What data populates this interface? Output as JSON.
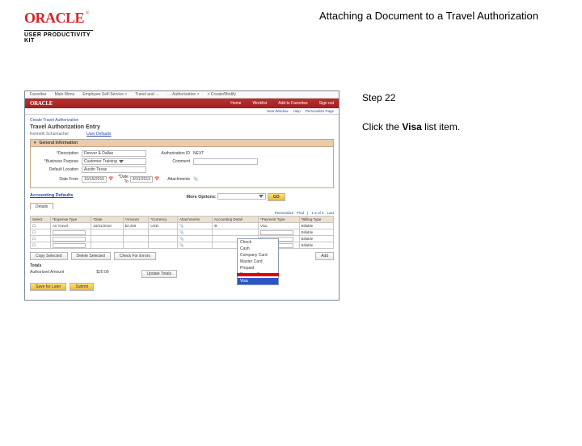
{
  "header": {
    "logo_wordmark": "ORACLE",
    "logo_subtitle": "USER PRODUCTIVITY KIT",
    "doc_title": "Attaching a Document to a Travel Authorization"
  },
  "instructions": {
    "step_label": "Step 22",
    "line1_pre": "Click the ",
    "line1_bold": "Visa",
    "line1_post": " list item."
  },
  "mini": {
    "menubar": [
      "Favorites",
      "Main Menu",
      "Employee Self-Service >",
      "Travel and …",
      "… Authorization >",
      "> Create/Modify"
    ],
    "redbar_brand": "ORACLE",
    "redbar_items": [
      "Home",
      "Worklist",
      "Add to Favorites",
      "Sign out"
    ],
    "subbar": [
      "New Window",
      "Help",
      "Personalize Page"
    ],
    "breadcrumb": "Create Travel Authorization",
    "page_title": "Travel Authorization Entry",
    "emp_name": "Kenneth Schumacher",
    "user_defaults_link": "User Defaults",
    "panel_header": "General Information",
    "form": {
      "desc_label": "*Description",
      "desc_value": "Denver & Dallas",
      "authid_label": "Authorization ID",
      "authid_value": "NEXT",
      "busp_label": "*Business Purpose",
      "busp_value": "Customer Training",
      "comment_label": "Comment",
      "loc_label": "Default Location",
      "loc_value": "Austin Texas",
      "datefrom_label": "Date From",
      "datefrom_value": "10/15/2010",
      "dateto_label": "*Date To",
      "dateto_value": "3/31/2013",
      "attach_label": "Attachments"
    },
    "section_left": "Accounting Defaults",
    "section_right": "More Options:",
    "go_btn": "GO",
    "tab": "Details",
    "table_tools": [
      "Personalize",
      "Find",
      "|",
      "1-4 of 4",
      "Last"
    ],
    "columns": [
      "Select",
      "*Expense Type",
      "*Date",
      "*Amount",
      "*Currency",
      "Attachments",
      "Accounting Detail",
      "*Payment Type",
      "*Billing Type"
    ],
    "row1": {
      "type": "Air Travel",
      "date": "10/31/2010",
      "amt": "$2,400",
      "cur": "USD",
      "pay": "Visa",
      "bill": "Billable"
    },
    "blank_bill": "Billable",
    "btns": [
      "Copy Selected",
      "Delete Selected",
      "Check For Errors",
      "Add"
    ],
    "totals_label": "Totals",
    "auth_amt_label": "Authorized Amount",
    "auth_amt_value": "$20.00",
    "update_btn": "Update Totals",
    "footer_btns": [
      "Save for Later",
      "Submit"
    ]
  },
  "dropdown": {
    "options": [
      "Check",
      "Cash",
      "Company Card",
      "Master Card",
      "Prepaid",
      "Program Rtrss",
      "Visa"
    ],
    "selected": "Visa"
  }
}
